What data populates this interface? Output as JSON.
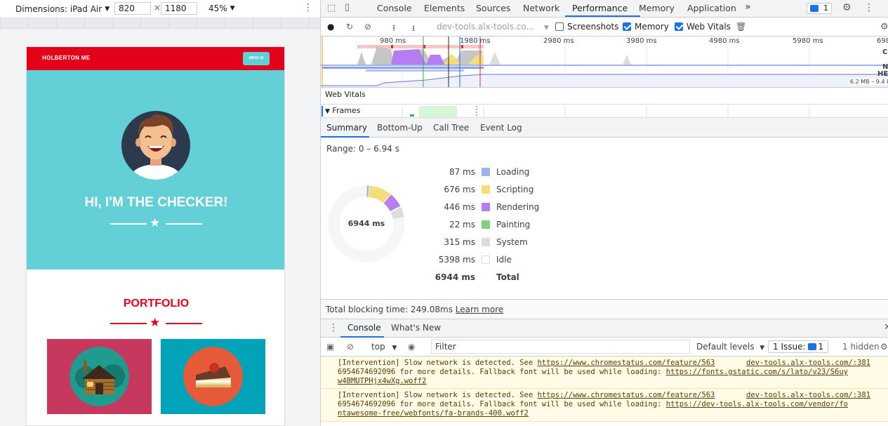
{
  "device_toolbar": {
    "dimensions_label": "Dimensions: iPad Air",
    "width_value": "820",
    "times": "×",
    "height_value": "1180",
    "zoom": "45%"
  },
  "site": {
    "brand": "HOLBERTON ME",
    "menu_label": "MENU ☰",
    "hero_title": "HI, I'M THE CHECKER!",
    "portfolio_title": "PORTFOLIO",
    "brand_color": "#e5001a",
    "hero_color": "#63cfd6"
  },
  "devtools": {
    "tabs": [
      "Console",
      "Elements",
      "Sources",
      "Network",
      "Performance",
      "Memory",
      "Application"
    ],
    "more_tabs": "»",
    "issue_count": "1",
    "url": "dev-tools.alx-tools.co...",
    "checkboxes": [
      {
        "label": "Screenshots",
        "checked": false
      },
      {
        "label": "Memory",
        "checked": true
      },
      {
        "label": "Web Vitals",
        "checked": true
      }
    ],
    "overview_ticks": [
      "980 ms",
      "1980 ms",
      "2980 ms",
      "3980 ms",
      "4980 ms",
      "5980 ms",
      "698"
    ],
    "overview_side": {
      "cpu": "CI",
      "net": "N",
      "heap": "HEA",
      "heap_range": "6.2 MB – 9.4 I"
    },
    "web_vitals_label": "Web Vitals",
    "frames_label": "Frames",
    "detail_tabs": [
      "Summary",
      "Bottom-Up",
      "Call Tree",
      "Event Log"
    ],
    "range": "Range: 0 – 6.94 s",
    "donut_total": "6944 ms",
    "summary": [
      {
        "value": "87 ms",
        "label": "Loading",
        "color": "#9fb3ec"
      },
      {
        "value": "676 ms",
        "label": "Scripting",
        "color": "#f2dd7a"
      },
      {
        "value": "446 ms",
        "label": "Rendering",
        "color": "#b57ef0"
      },
      {
        "value": "22 ms",
        "label": "Painting",
        "color": "#7fd07f"
      },
      {
        "value": "315 ms",
        "label": "System",
        "color": "#dadce0"
      },
      {
        "value": "5398 ms",
        "label": "Idle",
        "color": "#ffffff"
      }
    ],
    "summary_total": {
      "value": "6944 ms",
      "label": "Total"
    },
    "tbt_text": "Total blocking time: 249.08ms",
    "learn_more": "Learn more",
    "drawer_tabs": [
      "Console",
      "What's New"
    ],
    "console_context": "top",
    "filter_placeholder": "Filter",
    "default_levels": "Default levels",
    "issues_label_pre": "1 Issue:",
    "issues_label_count": "1",
    "hidden_label": "1 hidden",
    "messages": [
      {
        "text_a": "[Intervention] Slow network is detected. See ",
        "link": "https://www.chromestatus.com/feature/5636954674692096",
        "link_display": "https://www.chromestatus.com/feature/563",
        "text_b": "6954674692096 for more details. Fallback font will be used while loading: ",
        "font_url": "https://fonts.gstatic.com/s/lato/v23/S6uyw4BMUTPHjx4wXg.woff2",
        "font_a": "https://fonts.gstatic.com/s/lato/v23/S6uy",
        "font_b": "w4BMUTPHjx4wXg.woff2",
        "source": "dev-tools.alx-tools.com/:381"
      },
      {
        "text_a": "[Intervention] Slow network is detected. See ",
        "link_display": "https://www.chromestatus.com/feature/563",
        "text_b": "6954674692096 for more details. Fallback font will be used while loading: ",
        "font_a": "https://dev-tools.alx-tools.com/vendor/fo",
        "font_b": "ntawesome-free/webfonts/fa-brands-400.woff2",
        "source": "dev-tools.alx-tools.com/:381"
      }
    ]
  }
}
